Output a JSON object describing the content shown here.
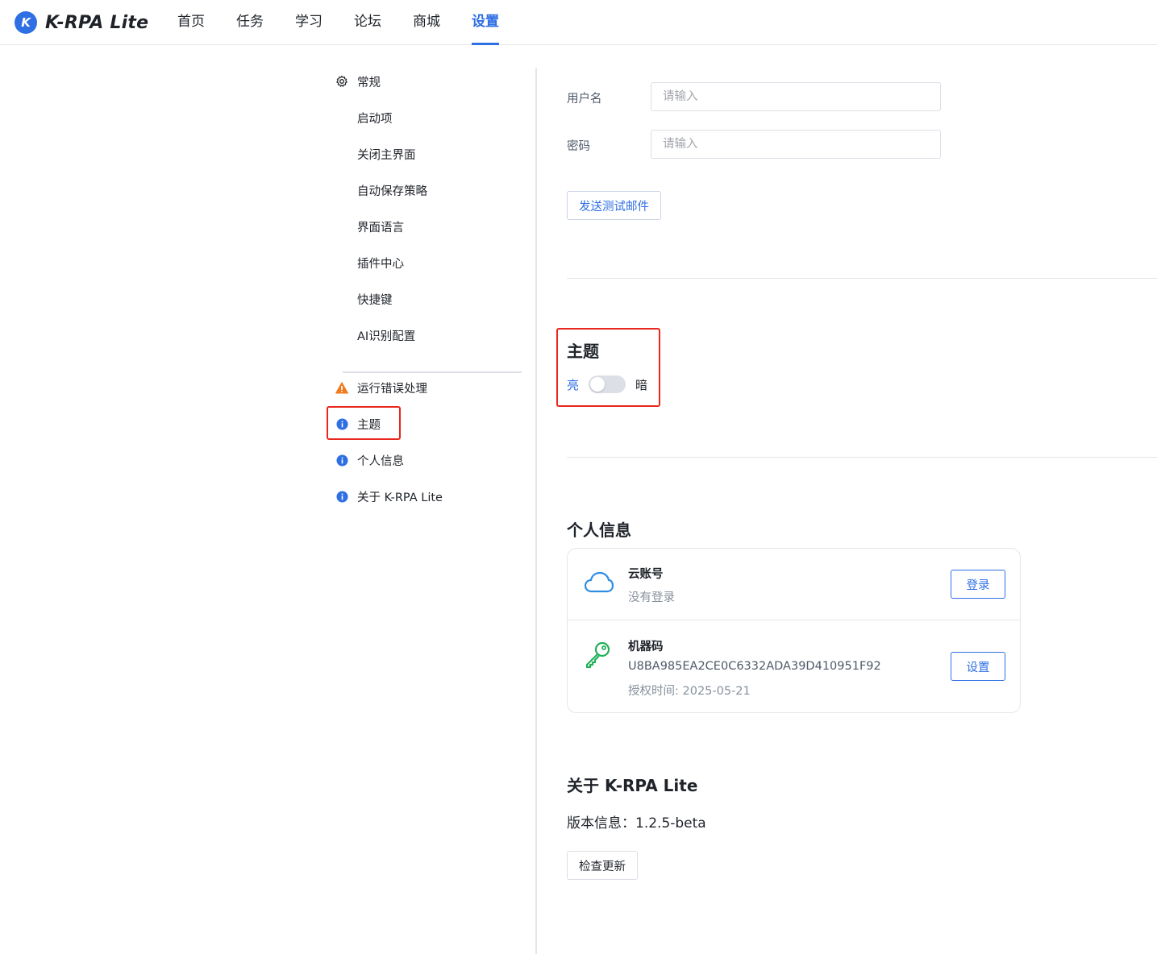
{
  "app": {
    "logo_letter": "K",
    "name": "K-RPA Lite",
    "brand_color": "#2f6fe4"
  },
  "nav": {
    "items": [
      {
        "label": "首页",
        "active": false
      },
      {
        "label": "任务",
        "active": false
      },
      {
        "label": "学习",
        "active": false
      },
      {
        "label": "论坛",
        "active": false
      },
      {
        "label": "商城",
        "active": false
      },
      {
        "label": "设置",
        "active": true
      }
    ]
  },
  "sidebar": {
    "items": [
      {
        "label": "常规",
        "icon": "gear-icon"
      },
      {
        "label": "启动项",
        "icon": ""
      },
      {
        "label": "关闭主界面",
        "icon": ""
      },
      {
        "label": "自动保存策略",
        "icon": ""
      },
      {
        "label": "界面语言",
        "icon": ""
      },
      {
        "label": "插件中心",
        "icon": ""
      },
      {
        "label": "快捷键",
        "icon": ""
      },
      {
        "label": "AI识别配置",
        "icon": ""
      },
      {
        "label": "运行错误处理",
        "icon": "warning-icon"
      },
      {
        "label": "主题",
        "icon": "info-icon"
      },
      {
        "label": "个人信息",
        "icon": "info-icon"
      },
      {
        "label": "关于 K-RPA Lite",
        "icon": "info-icon"
      }
    ]
  },
  "email": {
    "username_label": "用户名",
    "username_placeholder": "请输入",
    "password_label": "密码",
    "password_placeholder": "请输入",
    "send_test_button": "发送测试邮件"
  },
  "theme": {
    "title": "主题",
    "light_label": "亮",
    "dark_label": "暗",
    "dark_enabled": false
  },
  "profile": {
    "title": "个人信息",
    "cloud_title": "云账号",
    "cloud_status": "没有登录",
    "login_button": "登录",
    "machine_title": "机器码",
    "machine_code": "U8BA985EA2CE0C6332ADA39D410951F92",
    "auth_time": "授权时间: 2025-05-21",
    "settings_button": "设置"
  },
  "about": {
    "title": "关于 K-RPA Lite",
    "version_text": "版本信息：1.2.5-beta",
    "check_update_button": "检查更新"
  }
}
